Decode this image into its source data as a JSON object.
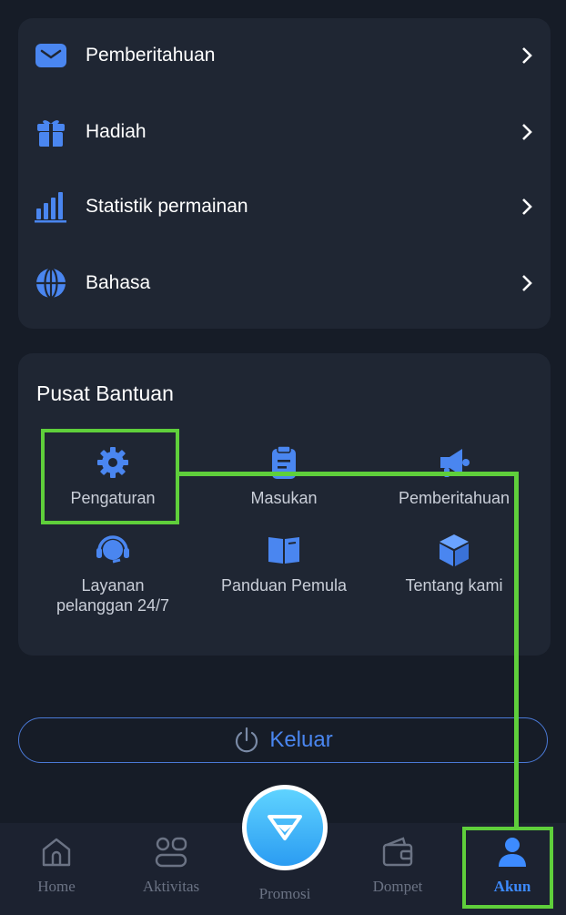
{
  "menu": {
    "items": [
      {
        "label": "Pemberitahuan",
        "icon": "envelope-icon"
      },
      {
        "label": "Hadiah",
        "icon": "gift-icon"
      },
      {
        "label": "Statistik permainan",
        "icon": "bar-chart-icon"
      },
      {
        "label": "Bahasa",
        "icon": "globe-icon"
      }
    ]
  },
  "help_center": {
    "title": "Pusat Bantuan",
    "items": [
      {
        "label": "Pengaturan",
        "icon": "gear-icon"
      },
      {
        "label": "Masukan",
        "icon": "clipboard-icon"
      },
      {
        "label": "Pemberitahuan",
        "icon": "megaphone-icon"
      },
      {
        "label": "Layanan pelanggan 24/7",
        "icon": "headset-icon"
      },
      {
        "label": "Panduan Pemula",
        "icon": "book-icon"
      },
      {
        "label": "Tentang kami",
        "icon": "cube-icon"
      }
    ]
  },
  "logout": {
    "label": "Keluar",
    "icon": "power-icon"
  },
  "bottom_nav": {
    "items": [
      {
        "label": "Home",
        "icon": "home-icon",
        "active": false
      },
      {
        "label": "Aktivitas",
        "icon": "activity-icon",
        "active": false
      },
      {
        "label": "Promosi",
        "icon": "diamond-icon",
        "active": false
      },
      {
        "label": "Dompet",
        "icon": "wallet-icon",
        "active": false
      },
      {
        "label": "Akun",
        "icon": "user-icon",
        "active": true
      }
    ]
  },
  "colors": {
    "background": "#161c27",
    "card": "#1f2633",
    "accent_blue": "#4a86f0",
    "highlight_green": "#5fcf3b",
    "nav_inactive": "#6b7384"
  }
}
